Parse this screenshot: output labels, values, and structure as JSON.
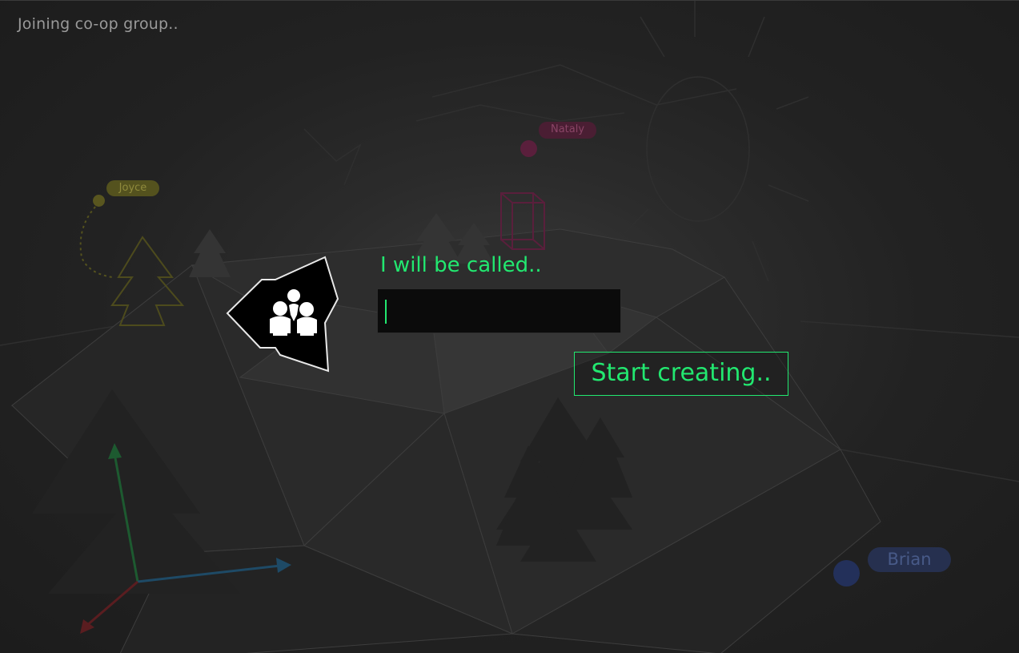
{
  "status": {
    "text": "Joining co-op group.."
  },
  "collaborators": [
    {
      "name": "Joyce",
      "color": "#8f8a3c"
    },
    {
      "name": "Nataly",
      "color": "#8a4466"
    },
    {
      "name": "Brian",
      "color": "#485a88"
    }
  ],
  "dialog": {
    "icon": "group-icon",
    "prompt": "I will be called..",
    "name_value": "",
    "start_label": "Start creating..",
    "accent_color": "#22e870"
  }
}
